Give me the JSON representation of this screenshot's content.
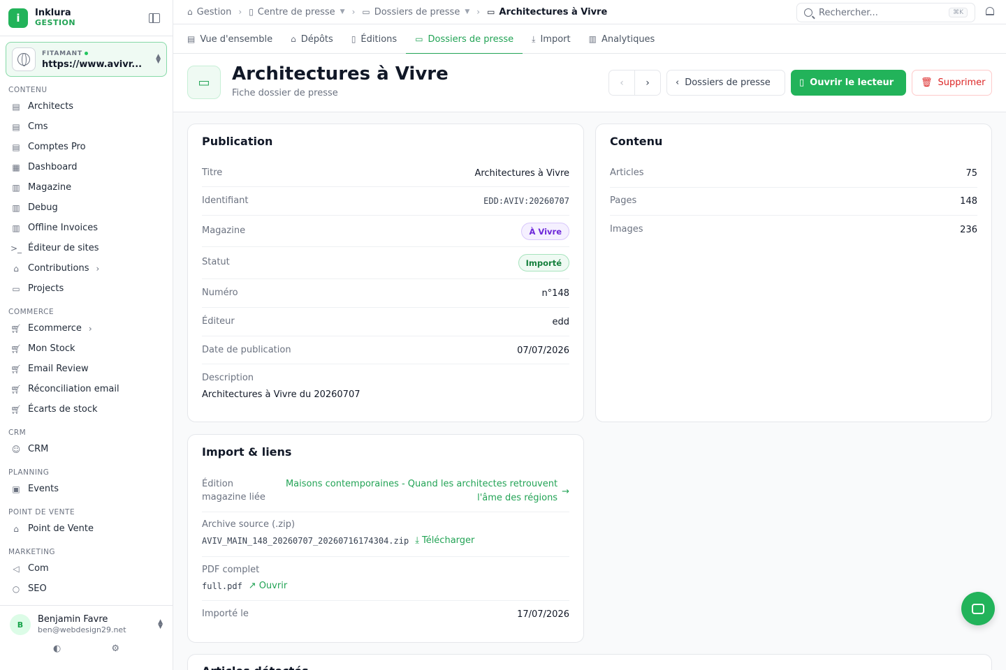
{
  "brand": {
    "name": "Inklura",
    "sub": "GESTION"
  },
  "site": {
    "tag": "FITAMANT",
    "url": "https://www.avivr..."
  },
  "sidebar": {
    "sections": [
      {
        "label": "CONTENU",
        "items": [
          {
            "label": "Architects",
            "icon": "document-icon"
          },
          {
            "label": "Cms",
            "icon": "document-icon"
          },
          {
            "label": "Comptes Pro",
            "icon": "document-icon"
          },
          {
            "label": "Dashboard",
            "icon": "grid-icon"
          },
          {
            "label": "Magazine",
            "icon": "newspaper-icon"
          },
          {
            "label": "Debug",
            "icon": "newspaper-icon"
          },
          {
            "label": "Offline Invoices",
            "icon": "newspaper-icon"
          },
          {
            "label": "Éditeur de sites",
            "icon": "terminal-icon"
          },
          {
            "label": "Contributions",
            "icon": "inbox-icon"
          },
          {
            "label": "Projects",
            "icon": "folder-icon"
          }
        ]
      },
      {
        "label": "COMMERCE",
        "items": [
          {
            "label": "Ecommerce",
            "icon": "cart-icon"
          },
          {
            "label": "Mon Stock",
            "icon": "cart-icon"
          },
          {
            "label": "Email Review",
            "icon": "cart-icon"
          },
          {
            "label": "Réconciliation email",
            "icon": "cart-icon"
          },
          {
            "label": "Écarts de stock",
            "icon": "cart-icon"
          }
        ]
      },
      {
        "label": "CRM",
        "items": [
          {
            "label": "CRM",
            "icon": "users-icon"
          }
        ]
      },
      {
        "label": "PLANNING",
        "items": [
          {
            "label": "Events",
            "icon": "calendar-icon"
          }
        ]
      },
      {
        "label": "POINT DE VENTE",
        "items": [
          {
            "label": "Point de Vente",
            "icon": "store-icon"
          }
        ]
      },
      {
        "label": "MARKETING",
        "items": [
          {
            "label": "Com",
            "icon": "megaphone-icon"
          },
          {
            "label": "SEO",
            "icon": "search-icon"
          }
        ]
      }
    ]
  },
  "user": {
    "initial": "B",
    "name": "Benjamin Favre",
    "email": "ben@webdesign29.net"
  },
  "breadcrumb": [
    "Gestion",
    "Centre de presse",
    "Dossiers de presse",
    "Architectures à Vivre"
  ],
  "search": {
    "placeholder": "Rechercher...",
    "shortcut": "⌘K"
  },
  "tabs": [
    "Vue d'ensemble",
    "Dépôts",
    "Éditions",
    "Dossiers de presse",
    "Import",
    "Analytiques"
  ],
  "header": {
    "title": "Architectures à Vivre",
    "subtitle": "Fiche dossier de presse",
    "back_label": "Dossiers de presse",
    "open_label": "Ouvrir le lecteur",
    "delete_label": "Supprimer"
  },
  "publication": {
    "title": "Publication",
    "titre_label": "Titre",
    "titre": "Architectures à Vivre",
    "identifiant_label": "Identifiant",
    "identifiant": "EDD:AVIV:20260707",
    "magazine_label": "Magazine",
    "magazine": "À Vivre",
    "statut_label": "Statut",
    "statut": "Importé",
    "numero_label": "Numéro",
    "numero": "n°148",
    "editeur_label": "Éditeur",
    "editeur": "edd",
    "date_label": "Date de publication",
    "date": "07/07/2026",
    "description_label": "Description",
    "description": "Architectures à Vivre du 20260707"
  },
  "contenu": {
    "title": "Contenu",
    "articles_label": "Articles",
    "articles": "75",
    "pages_label": "Pages",
    "pages": "148",
    "images_label": "Images",
    "images": "236"
  },
  "import": {
    "title": "Import & liens",
    "edition_label_1": "Édition",
    "edition_label_2": "magazine liée",
    "edition_link_1": "Maisons contemporaines - Quand les architectes retrouvent",
    "edition_link_2": "l'âme des régions",
    "archive_label": "Archive source (.zip)",
    "archive_file": "AVIV_MAIN_148_20260707_20260716174304.zip",
    "archive_action": "Télécharger",
    "pdf_label": "PDF complet",
    "pdf_file": "full.pdf",
    "pdf_action": "Ouvrir",
    "imported_label": "Importé le",
    "imported": "17/07/2026"
  },
  "articles_section": {
    "title": "Articles détectés"
  },
  "colors": {
    "accent": "#22b35a",
    "danger": "#dc2626",
    "purple": "#6d28d9"
  }
}
